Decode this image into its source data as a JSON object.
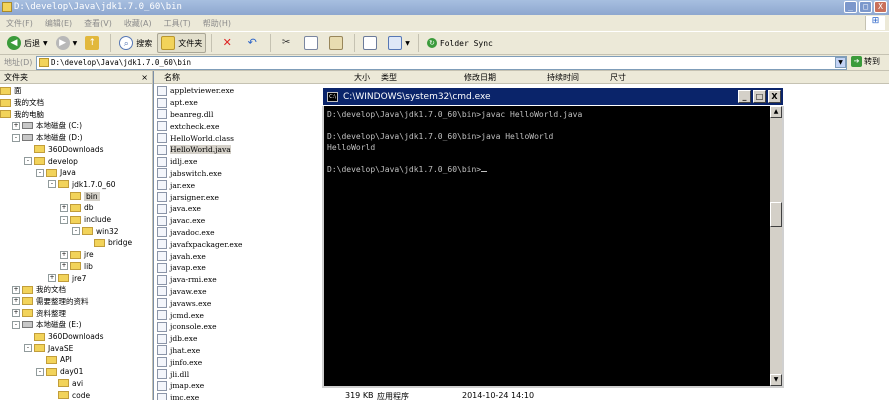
{
  "window": {
    "title": "D:\\develop\\Java\\jdk1.7.0_60\\bin",
    "buttons": [
      "_",
      "□",
      "X"
    ]
  },
  "menu": [
    "文件(F)",
    "编辑(E)",
    "查看(V)",
    "收藏(A)",
    "工具(T)",
    "帮助(H)"
  ],
  "toolbar": {
    "back": "后退",
    "search": "搜索",
    "folders": "文件夹",
    "folder_sync": "Folder Sync"
  },
  "address": {
    "label": "地址(D)",
    "value": "D:\\develop\\Java\\jdk1.7.0_60\\bin",
    "go": "转到"
  },
  "folder_pane": {
    "title": "文件夹",
    "close": "×",
    "items": [
      {
        "label": "面",
        "level": 0,
        "expander": "",
        "icon": "desktop"
      },
      {
        "label": "我的文档",
        "level": 0,
        "expander": "",
        "icon": "folder"
      },
      {
        "label": "我的电脑",
        "level": 0,
        "expander": "",
        "icon": "computer"
      },
      {
        "label": "本地磁盘 (C:)",
        "level": 1,
        "expander": "+",
        "icon": "drive"
      },
      {
        "label": "本地磁盘 (D:)",
        "level": 1,
        "expander": "-",
        "icon": "drive"
      },
      {
        "label": "360Downloads",
        "level": 2,
        "expander": "",
        "icon": "folder"
      },
      {
        "label": "develop",
        "level": 2,
        "expander": "-",
        "icon": "folder"
      },
      {
        "label": "Java",
        "level": 3,
        "expander": "-",
        "icon": "folder"
      },
      {
        "label": "jdk1.7.0_60",
        "level": 4,
        "expander": "-",
        "icon": "folder"
      },
      {
        "label": "bin",
        "level": 5,
        "expander": "",
        "icon": "folder",
        "selected": true
      },
      {
        "label": "db",
        "level": 5,
        "expander": "+",
        "icon": "folder"
      },
      {
        "label": "include",
        "level": 5,
        "expander": "-",
        "icon": "folder"
      },
      {
        "label": "win32",
        "level": 6,
        "expander": "-",
        "icon": "folder"
      },
      {
        "label": "bridge",
        "level": 7,
        "expander": "",
        "icon": "folder"
      },
      {
        "label": "jre",
        "level": 5,
        "expander": "+",
        "icon": "folder"
      },
      {
        "label": "lib",
        "level": 5,
        "expander": "+",
        "icon": "folder"
      },
      {
        "label": "jre7",
        "level": 4,
        "expander": "+",
        "icon": "folder"
      },
      {
        "label": "我的文档",
        "level": 1,
        "expander": "+",
        "icon": "folder"
      },
      {
        "label": "需要整理的资料",
        "level": 1,
        "expander": "+",
        "icon": "folder"
      },
      {
        "label": "资料整理",
        "level": 1,
        "expander": "+",
        "icon": "folder"
      },
      {
        "label": "本地磁盘 (E:)",
        "level": 1,
        "expander": "-",
        "icon": "drive"
      },
      {
        "label": "360Downloads",
        "level": 2,
        "expander": "",
        "icon": "folder"
      },
      {
        "label": "JavaSE",
        "level": 2,
        "expander": "-",
        "icon": "folder"
      },
      {
        "label": "API",
        "level": 3,
        "expander": "",
        "icon": "folder"
      },
      {
        "label": "day01",
        "level": 3,
        "expander": "-",
        "icon": "folder"
      },
      {
        "label": "avi",
        "level": 4,
        "expander": "",
        "icon": "folder"
      },
      {
        "label": "code",
        "level": 4,
        "expander": "",
        "icon": "folder"
      }
    ]
  },
  "file_list": {
    "columns": [
      "名称",
      "大小",
      "类型",
      "修改日期",
      "持续时间",
      "尺寸"
    ],
    "files": [
      "appletviewer.exe",
      "apt.exe",
      "beanreg.dll",
      "extcheck.exe",
      "HelloWorld.class",
      "HelloWorld.java",
      "idlj.exe",
      "jabswitch.exe",
      "jar.exe",
      "jarsigner.exe",
      "java.exe",
      "javac.exe",
      "javadoc.exe",
      "javafxpackager.exe",
      "javah.exe",
      "javap.exe",
      "java-rmi.exe",
      "javaw.exe",
      "javaws.exe",
      "jcmd.exe",
      "jconsole.exe",
      "jdb.exe",
      "jhat.exe",
      "jinfo.exe",
      "jli.dll",
      "jmap.exe",
      "jmc.exe"
    ],
    "selected_file": "HelloWorld.java",
    "last_row": {
      "size": "319 KB",
      "type": "应用程序",
      "modified": "2014-10-24 14:10"
    }
  },
  "cmd": {
    "title": "C:\\WINDOWS\\system32\\cmd.exe",
    "icon_text": "C:\\",
    "buttons": [
      "_",
      "□",
      "X"
    ],
    "lines": [
      "D:\\develop\\Java\\jdk1.7.0_60\\bin>javac HelloWorld.java",
      "",
      "D:\\develop\\Java\\jdk1.7.0_60\\bin>java HelloWorld",
      "HelloWorld",
      "",
      "D:\\develop\\Java\\jdk1.7.0_60\\bin>"
    ],
    "scroll_arrows": [
      "▲",
      "▼"
    ]
  }
}
